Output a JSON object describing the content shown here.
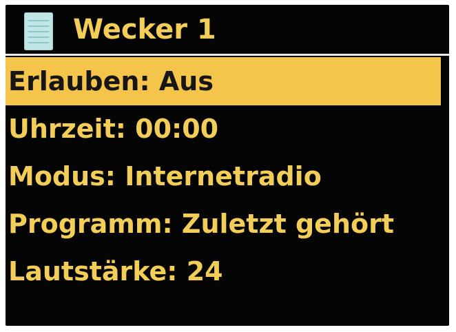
{
  "screen": {
    "title": "Wecker 1",
    "icon": "list-icon",
    "colors": {
      "background": "#050505",
      "text": "#f2cd58",
      "selected_background": "#f4c44b",
      "selected_text": "#161616"
    }
  },
  "menu": {
    "items": [
      {
        "label": "Erlauben: Aus",
        "selected": true
      },
      {
        "label": "Uhrzeit: 00:00",
        "selected": false
      },
      {
        "label": "Modus: Internetradio",
        "selected": false
      },
      {
        "label": "Programm: Zuletzt gehört",
        "selected": false
      },
      {
        "label": "Lautstärke: 24",
        "selected": false
      }
    ]
  }
}
